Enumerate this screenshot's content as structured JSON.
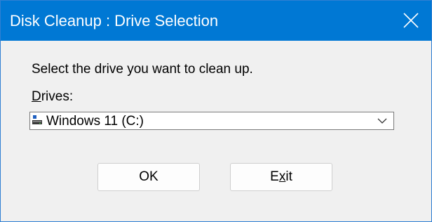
{
  "window": {
    "title": "Disk Cleanup : Drive Selection",
    "accent_color": "#0078d4",
    "close_icon": "close-icon"
  },
  "dialog": {
    "instruction": "Select the drive you want to clean up.",
    "drives_label_first": "D",
    "drives_label_rest": "rives:",
    "selected_drive": "Windows 11 (C:)",
    "drive_icon": "drive-icon",
    "dropdown_icon": "chevron-down-icon"
  },
  "buttons": {
    "ok_label": "OK",
    "exit_label_first": "E",
    "exit_label_mnemonic": "x",
    "exit_label_rest": "it"
  }
}
